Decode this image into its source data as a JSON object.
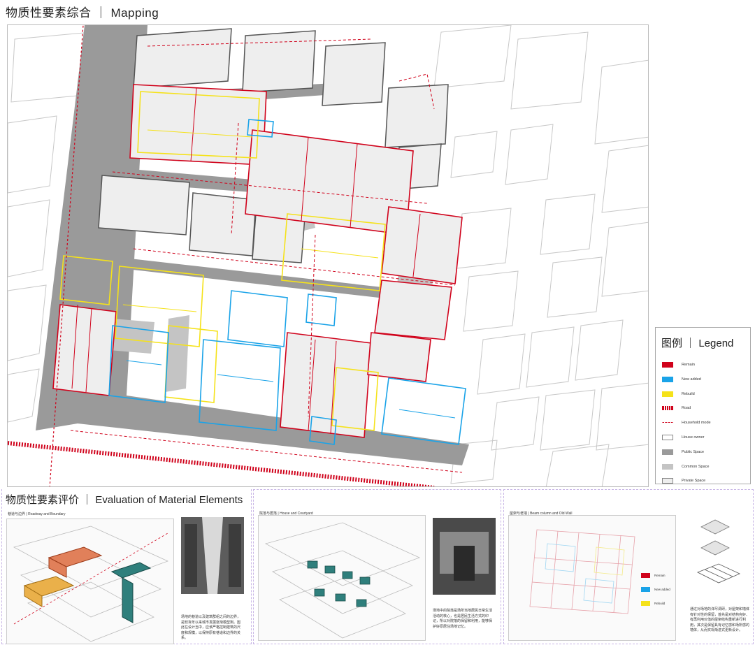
{
  "header": {
    "title": "物质性要素综合 ｜ Mapping"
  },
  "legend": {
    "title": "图例 ｜ Legend",
    "items": [
      {
        "label": "Remain",
        "color": "#d0021b",
        "kind": "fill"
      },
      {
        "label": "New added",
        "color": "#1aa3e8",
        "kind": "fill"
      },
      {
        "label": "Rebuild",
        "color": "#f5e21a",
        "kind": "fill"
      },
      {
        "label": "Road",
        "color": "#d0021b",
        "kind": "dash"
      },
      {
        "label": "Household mode",
        "color": "#d0021b",
        "kind": "arrow"
      },
      {
        "label": "House owner",
        "color": "#ffffff",
        "kind": "outline"
      },
      {
        "label": "Public Space",
        "color": "#9a9a9a",
        "kind": "fill"
      },
      {
        "label": "Common Space",
        "color": "#c4c4c4",
        "kind": "fill"
      },
      {
        "label": "Private Space",
        "color": "#eeeeee",
        "kind": "outline"
      }
    ]
  },
  "evaluation": {
    "title": "物质性要素评价 ｜ Evaluation of Material Elements",
    "panels": [
      {
        "label": "巷道与边界 | Roadway and Boundary",
        "caption": "场地的巷道以及建筑群组之间的边界，是较百年以来城市发展逐渐模型剩。因此在设计当中，应该严格控制建筑的尺度和规模，以保持原有巷道和边界的关系。"
      },
      {
        "label": "院落与居落 | House and Courtyard",
        "caption": "场地中的院落是场所当地居民日常生活活动的核心，也是居民生活方式的印记，所以对院落的保留和利用，能够保护好原居住场地记忆。"
      },
      {
        "label": "屋架与老墙 | Beam column and Old Wall",
        "caption": "通过对场地的详尽调研，对屋架和墙体有针对性的保留，首先是对结构完好、有再利用价值的屋架结构重新进行利用，其次是保留具有记忆感和场所感的墙体，从而实现渐进式更新设计。",
        "legend": [
          {
            "label": "Remain",
            "color": "#d0021b"
          },
          {
            "label": "New added",
            "color": "#1aa3e8"
          },
          {
            "label": "Rebuild",
            "color": "#f5e21a"
          }
        ]
      }
    ]
  }
}
